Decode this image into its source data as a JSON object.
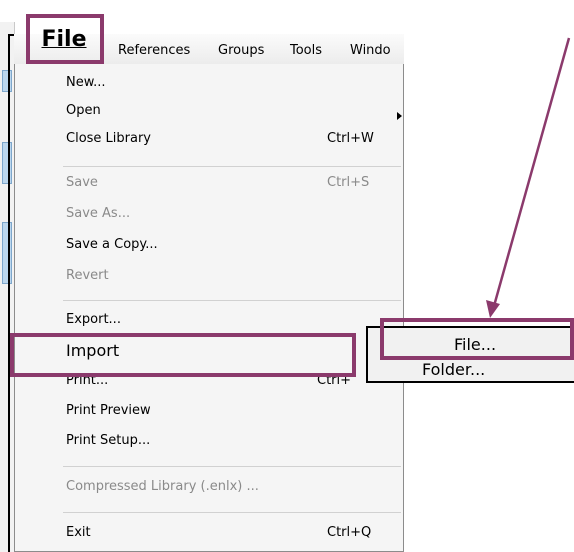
{
  "menubar": {
    "file": "File",
    "items": [
      "References",
      "Groups",
      "Tools",
      "Windo"
    ]
  },
  "file_menu": {
    "items": [
      {
        "label": "New...",
        "shortcut": "",
        "disabled": false
      },
      {
        "label": "Open",
        "shortcut": "",
        "disabled": false,
        "submenu": true
      },
      {
        "label": "Close Library",
        "shortcut": "Ctrl+W",
        "disabled": false
      },
      {
        "label": "Save",
        "shortcut": "Ctrl+S",
        "disabled": true
      },
      {
        "label": "Save As...",
        "shortcut": "",
        "disabled": true
      },
      {
        "label": "Save a Copy...",
        "shortcut": "",
        "disabled": false
      },
      {
        "label": "Revert",
        "shortcut": "",
        "disabled": true
      },
      {
        "label": "Export...",
        "shortcut": "",
        "disabled": false
      },
      {
        "label": "Import",
        "shortcut": "",
        "disabled": false
      },
      {
        "label": "Print...",
        "shortcut": "Ctrl+",
        "disabled": false
      },
      {
        "label": "Print Preview",
        "shortcut": "",
        "disabled": false
      },
      {
        "label": "Print Setup...",
        "shortcut": "",
        "disabled": false
      },
      {
        "label": "Compressed Library (.enlx) ...",
        "shortcut": "",
        "disabled": true
      },
      {
        "label": "Exit",
        "shortcut": "Ctrl+Q",
        "disabled": false
      }
    ]
  },
  "import_submenu": {
    "items": [
      "File...",
      "Folder..."
    ]
  },
  "colors": {
    "highlight": "#8b3a6c",
    "arrow": "#8b3a6c"
  }
}
